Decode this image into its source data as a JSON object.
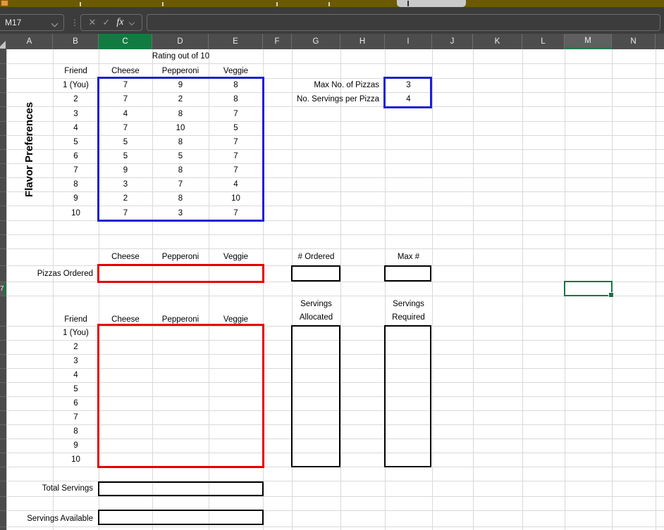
{
  "app": {
    "name_box": "M17",
    "fx": "fx",
    "cancel": "✕",
    "enter": "✓",
    "formula": "",
    "dots": "⋮"
  },
  "grid": {
    "columns": [
      "A",
      "B",
      "C",
      "D",
      "E",
      "F",
      "G",
      "H",
      "I",
      "J",
      "K",
      "L",
      "M",
      "N"
    ],
    "selected_cell": "M17",
    "row17_digit": "7"
  },
  "colors": {
    "excel_green": "#107C41",
    "active_border": "#1E7145",
    "selection_blue": "#1F1FD7",
    "input_red": "#E80000",
    "titlebar_olive": "#6C5A01"
  },
  "sheet": {
    "flavor_label": "Flavor Preferences",
    "ratings_title": "Rating out of 10",
    "table1": {
      "headers": [
        "Friend",
        "Cheese",
        "Pepperoni",
        "Veggie"
      ],
      "rows": [
        {
          "friend": "1 (You)",
          "cheese": "7",
          "pepperoni": "9",
          "veggie": "8"
        },
        {
          "friend": "2",
          "cheese": "7",
          "pepperoni": "2",
          "veggie": "8"
        },
        {
          "friend": "3",
          "cheese": "4",
          "pepperoni": "8",
          "veggie": "7"
        },
        {
          "friend": "4",
          "cheese": "7",
          "pepperoni": "10",
          "veggie": "5"
        },
        {
          "friend": "5",
          "cheese": "5",
          "pepperoni": "8",
          "veggie": "7"
        },
        {
          "friend": "6",
          "cheese": "5",
          "pepperoni": "5",
          "veggie": "7"
        },
        {
          "friend": "7",
          "cheese": "9",
          "pepperoni": "8",
          "veggie": "7"
        },
        {
          "friend": "8",
          "cheese": "3",
          "pepperoni": "7",
          "veggie": "4"
        },
        {
          "friend": "9",
          "cheese": "2",
          "pepperoni": "8",
          "veggie": "10"
        },
        {
          "friend": "10",
          "cheese": "7",
          "pepperoni": "3",
          "veggie": "7"
        }
      ]
    },
    "params": [
      {
        "label": "Max No. of Pizzas",
        "value": "3"
      },
      {
        "label": "No. Servings per Pizza",
        "value": "4"
      }
    ],
    "order_section": {
      "headers": [
        "Cheese",
        "Pepperoni",
        "Veggie"
      ],
      "row_label": "Pizzas Ordered",
      "ordered_header": "# Ordered",
      "max_header": "Max #"
    },
    "allocation_section": {
      "headers": [
        "Friend",
        "Cheese",
        "Pepperoni",
        "Veggie"
      ],
      "friends": [
        "1 (You)",
        "2",
        "3",
        "4",
        "5",
        "6",
        "7",
        "8",
        "9",
        "10"
      ],
      "allocated_header": {
        "line1": "Servings",
        "line2": "Allocated"
      },
      "required_header": {
        "line1": "Servings",
        "line2": "Required"
      }
    },
    "totals": {
      "total_servings_label": "Total Servings",
      "servings_available_label": "Servings Available"
    }
  }
}
